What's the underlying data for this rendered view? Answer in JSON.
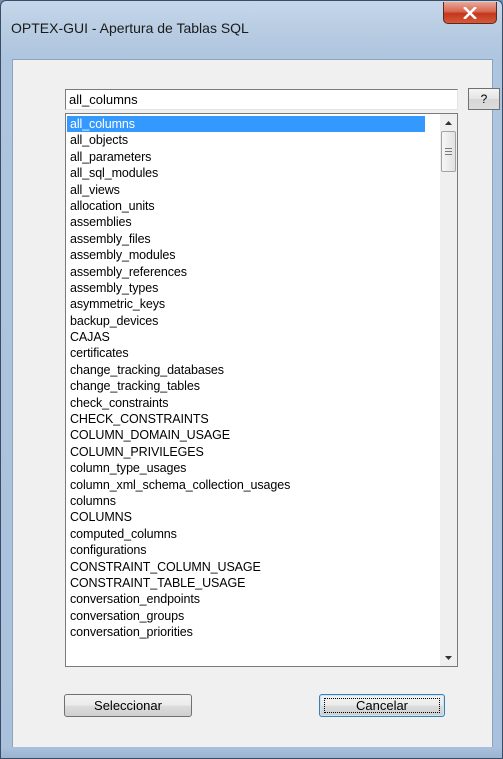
{
  "window": {
    "title": "OPTEX-GUI - Apertura de Tablas SQL",
    "close_icon": "close-icon"
  },
  "search": {
    "value": "all_columns",
    "help_label": "?"
  },
  "list": {
    "selected_index": 0,
    "items": [
      "all_columns",
      "all_objects",
      "all_parameters",
      "all_sql_modules",
      "all_views",
      "allocation_units",
      "assemblies",
      "assembly_files",
      "assembly_modules",
      "assembly_references",
      "assembly_types",
      "asymmetric_keys",
      "backup_devices",
      "CAJAS",
      "certificates",
      "change_tracking_databases",
      "change_tracking_tables",
      "check_constraints",
      "CHECK_CONSTRAINTS",
      "COLUMN_DOMAIN_USAGE",
      "COLUMN_PRIVILEGES",
      "column_type_usages",
      "column_xml_schema_collection_usages",
      "columns",
      "COLUMNS",
      "computed_columns",
      "configurations",
      "CONSTRAINT_COLUMN_USAGE",
      "CONSTRAINT_TABLE_USAGE",
      "conversation_endpoints",
      "conversation_groups",
      "conversation_priorities"
    ]
  },
  "buttons": {
    "select_label": "Seleccionar",
    "cancel_label": "Cancelar"
  },
  "colors": {
    "selection": "#3399ff",
    "close_button": "#c2371d"
  }
}
